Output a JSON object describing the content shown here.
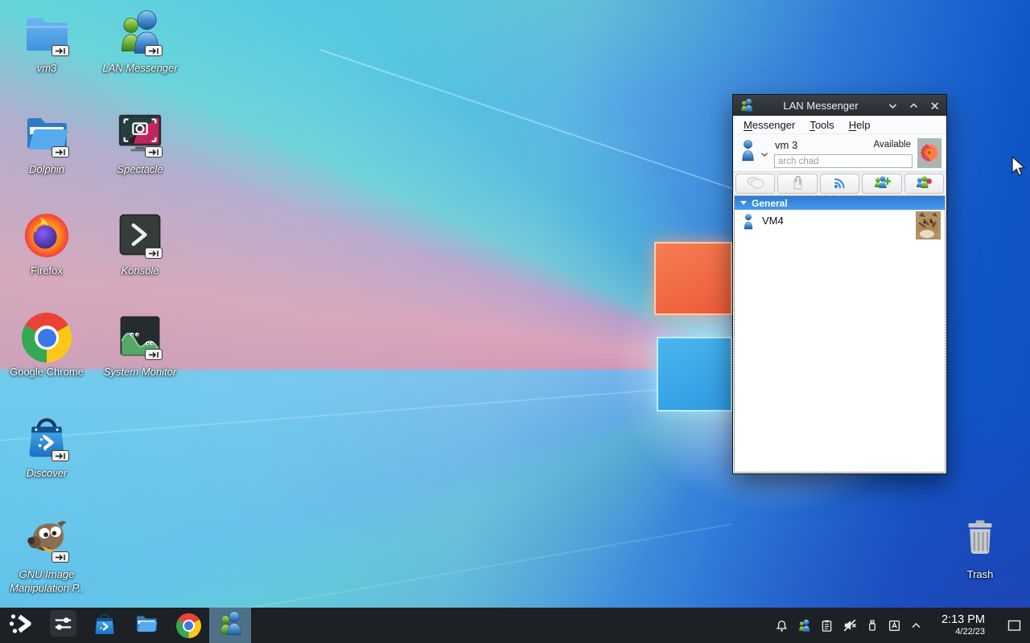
{
  "desktop": {
    "icons": [
      {
        "name": "vm3",
        "label": "vm3",
        "symlink": true
      },
      {
        "name": "lan-messenger",
        "label": "LAN Messenger",
        "symlink": true
      },
      {
        "name": "dolphin",
        "label": "Dolphin",
        "symlink": true
      },
      {
        "name": "spectacle",
        "label": "Spectacle",
        "symlink": true
      },
      {
        "name": "firefox",
        "label": "Firefox",
        "symlink": false
      },
      {
        "name": "konsole",
        "label": "Konsole",
        "symlink": true
      },
      {
        "name": "google-chrome",
        "label": "Google Chrome",
        "symlink": false
      },
      {
        "name": "system-monitor",
        "label": "System Monitor",
        "symlink": true
      },
      {
        "name": "discover",
        "label": "Discover",
        "symlink": true
      },
      {
        "name": "gimp",
        "label": "GNU Image Manipulation P..",
        "symlink": true
      },
      {
        "name": "trash",
        "label": "Trash",
        "symlink": false
      }
    ]
  },
  "window": {
    "title": "LAN Messenger",
    "controls": [
      "minimize-icon",
      "maximize-icon",
      "close-icon"
    ],
    "menu": [
      {
        "label": "Messenger"
      },
      {
        "label": "Tools"
      },
      {
        "label": "Help"
      }
    ],
    "user": {
      "name": "vm 3",
      "presence": "Available",
      "status_message": "arch chad",
      "avatar": "flower-photo"
    },
    "toolbar": [
      {
        "icon": "chat-icon",
        "enabled": false
      },
      {
        "icon": "attach-file-icon",
        "enabled": false
      },
      {
        "icon": "broadcast-icon",
        "enabled": true
      },
      {
        "icon": "add-contact-icon",
        "enabled": true
      },
      {
        "icon": "contact-settings-icon",
        "enabled": true
      }
    ],
    "groups": [
      {
        "label": "General",
        "expanded": true,
        "contacts": [
          {
            "name": "VM4",
            "avatar": "kitten-photo"
          }
        ]
      }
    ]
  },
  "taskbar": {
    "apps": [
      {
        "icon": "app-launcher-icon",
        "active": false
      },
      {
        "icon": "system-settings-icon",
        "active": false
      },
      {
        "icon": "discover-icon",
        "active": false
      },
      {
        "icon": "dolphin-icon",
        "active": false
      },
      {
        "icon": "chrome-icon",
        "active": false
      },
      {
        "icon": "lan-messenger-icon",
        "active": true
      }
    ]
  },
  "tray": {
    "icons": [
      "notifications-icon",
      "lan-messenger-tray-icon",
      "clipboard-icon",
      "volume-muted-icon",
      "usb-device-icon",
      "keyboard-layout-icon",
      "expand-tray-icon"
    ],
    "clock": {
      "time": "2:13 PM",
      "date": "4/22/23"
    },
    "show_desktop": "show-desktop-icon"
  },
  "colors": {
    "accent": "#3086e8",
    "taskbar_bg": "#1d2125",
    "titlebar_bg": "#2f343a",
    "group_header": "#2c79d4",
    "active_task": "#4e7187",
    "logo_orange": "#ee5c38",
    "logo_blue": "#2f9ce3"
  }
}
